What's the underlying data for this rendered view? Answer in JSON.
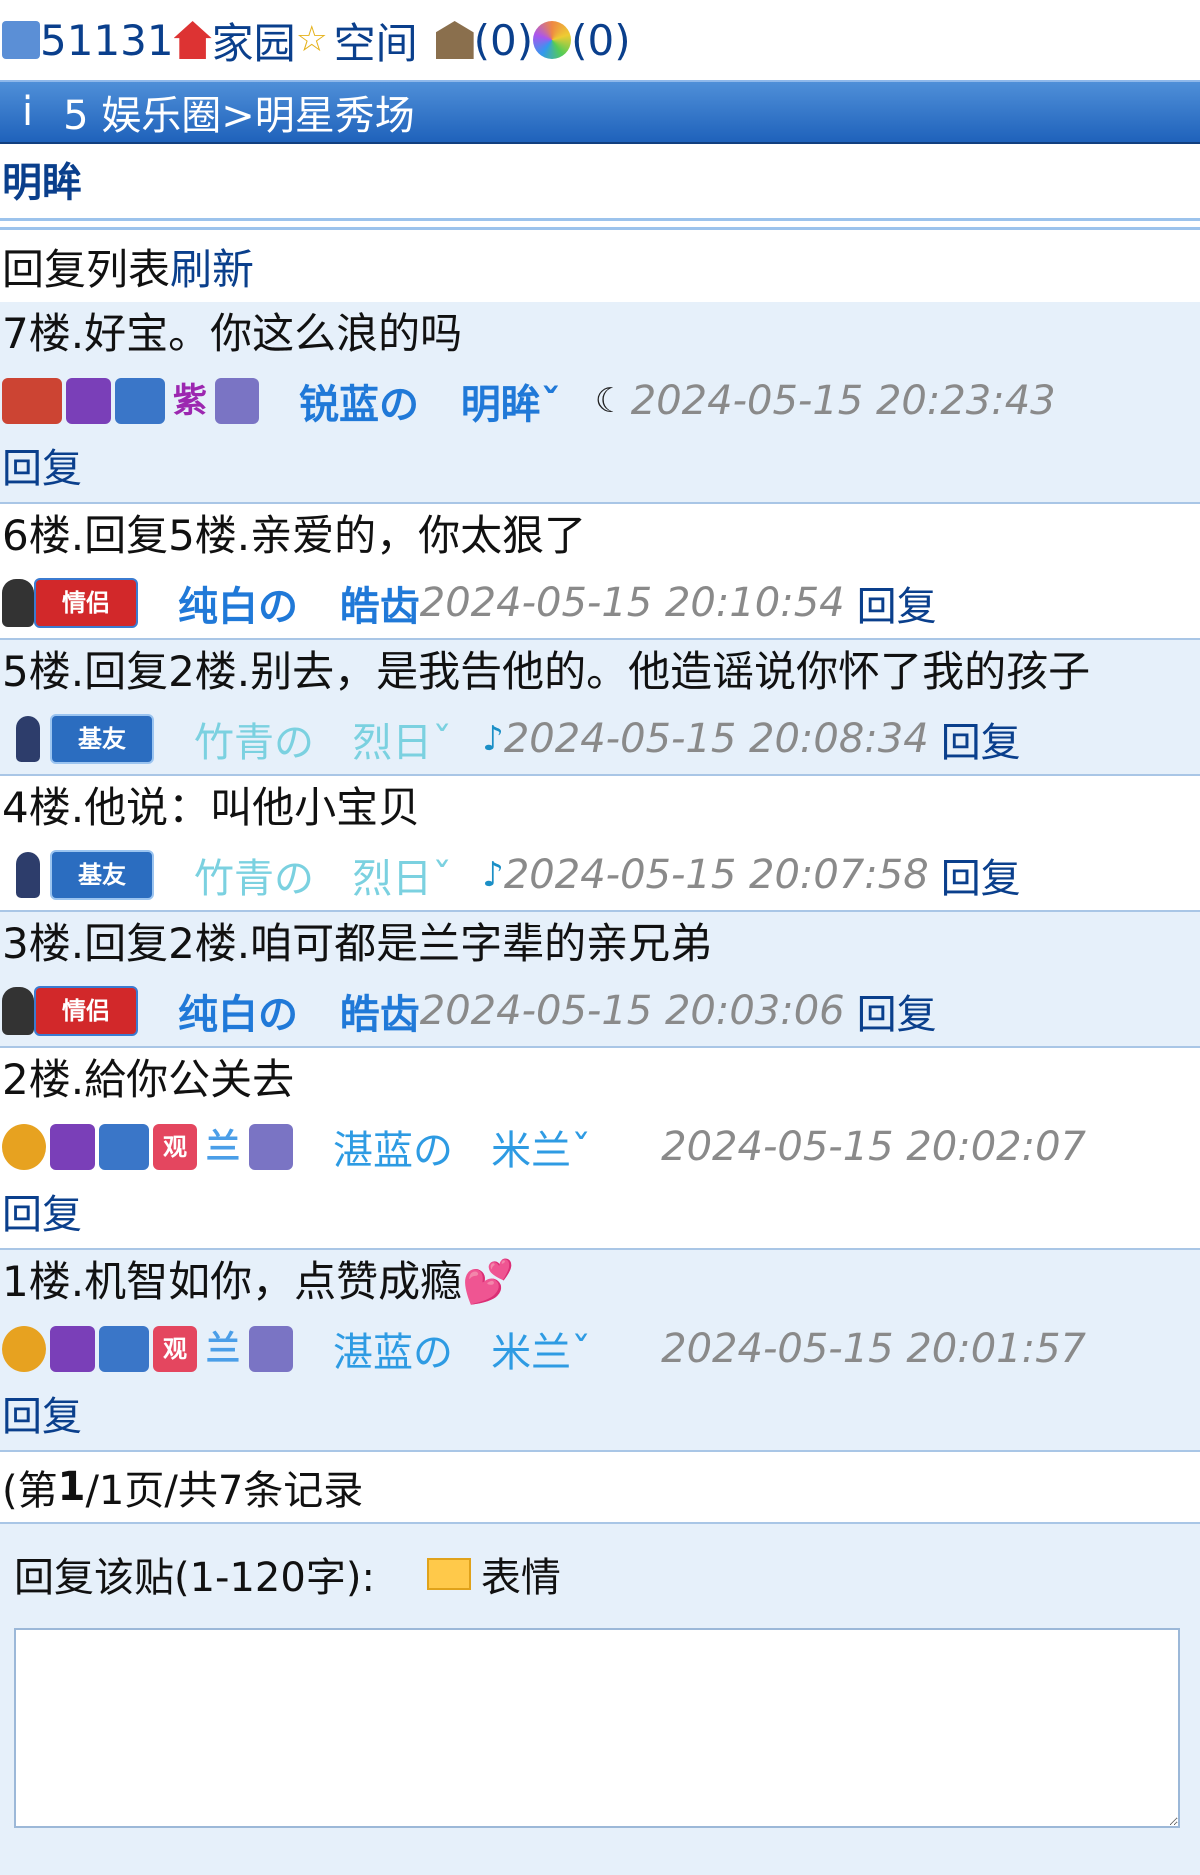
{
  "topbar": {
    "user_id": "51131",
    "home_label": "家园",
    "space_label": "空间",
    "mail_count": "(0)",
    "album_count": "(0)",
    "icons": [
      "user-card-icon",
      "house-icon",
      "star-icon",
      "bank-icon",
      "aperture-icon"
    ]
  },
  "navbar": {
    "info_glyph": "i",
    "path": "5 娱乐圈>明星秀场"
  },
  "thread": {
    "title": "明眸"
  },
  "list": {
    "label": "回复列表",
    "refresh": "刷新"
  },
  "posts": [
    {
      "content": "7楼.好宝。你这么浪的吗",
      "user_prefix": "锐蓝の",
      "user_name": "明眸ˇ",
      "time": "2024-05-15 20:23:43",
      "reply": "回复"
    },
    {
      "content": "6楼.回复5楼.亲爱的，你太狠了",
      "user_prefix": "纯白の",
      "user_name": "皓齿",
      "time": "2024-05-15 20:10:54",
      "reply": "回复",
      "badge": "情侣"
    },
    {
      "content": "5楼.回复2楼.别去，是我告他的。他造谣说你怀了我的孩子",
      "user_prefix": "竹青の",
      "user_name": "烈日ˇ",
      "time": "2024-05-15 20:08:34",
      "reply": "回复",
      "badge": "基友"
    },
    {
      "content": "4楼.他说：叫他小宝贝",
      "user_prefix": "竹青の",
      "user_name": "烈日ˇ",
      "time": "2024-05-15 20:07:58",
      "reply": "回复",
      "badge": "基友"
    },
    {
      "content": "3楼.回复2楼.咱可都是兰字辈的亲兄弟",
      "user_prefix": "纯白の",
      "user_name": "皓齿",
      "time": "2024-05-15 20:03:06",
      "reply": "回复",
      "badge": "情侣"
    },
    {
      "content": "2楼.給你公关去",
      "user_prefix": "湛蓝の",
      "user_name": "米兰ˇ",
      "time": "2024-05-15 20:02:07",
      "reply": "回复"
    },
    {
      "content": "1楼.机智如你，点赞成瘾",
      "user_prefix": "湛蓝の",
      "user_name": "米兰ˇ",
      "time": "2024-05-15 20:01:57",
      "reply": "回复"
    }
  ],
  "badges": {
    "zi": "紫",
    "lan": "兰",
    "guan": "观"
  },
  "pager": {
    "text_a": "(第",
    "page": "1",
    "text_b": "/1页/共7条记录"
  },
  "form": {
    "label": "回复该贴(1-120字):",
    "emoji_label": "表情"
  },
  "colors": {
    "navbar": "#2f74c8",
    "link": "#0a3f8c",
    "alt_row": "#e6f0fa",
    "time": "#8a8a8a"
  }
}
